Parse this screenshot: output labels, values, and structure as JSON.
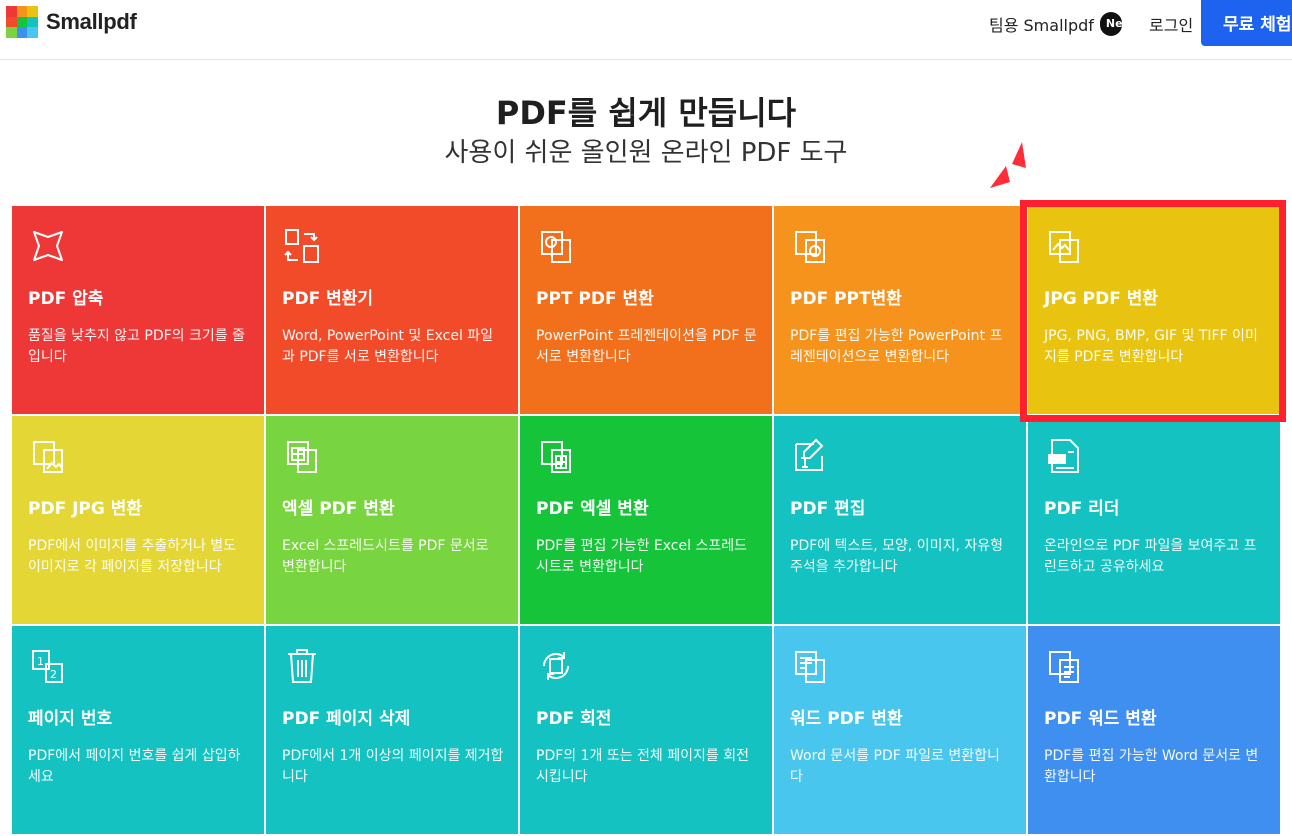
{
  "header": {
    "brand": "Smallpdf",
    "team_label": "팀용 Smallpdf",
    "new_badge": "New",
    "login_label": "로그인",
    "trial_label": "무료 체험"
  },
  "hero": {
    "title": "PDF를 쉽게 만듭니다",
    "subtitle": "사용이 쉬운 올인원 온라인 PDF 도구"
  },
  "tools": [
    {
      "title": "PDF 압축",
      "desc": "품질을 낮추지 않고 PDF의 크기를 줄입니다",
      "color": "#ee3838",
      "icon": "compress-icon"
    },
    {
      "title": "PDF 변환기",
      "desc": "Word, PowerPoint 및 Excel 파일과 PDF를 서로 변환합니다",
      "color": "#f24b2a",
      "icon": "convert-icon"
    },
    {
      "title": "PPT PDF 변환",
      "desc": "PowerPoint 프레젠테이션을 PDF 문서로 변환합니다",
      "color": "#f26f1c",
      "icon": "ppt-to-pdf-icon"
    },
    {
      "title": "PDF PPT변환",
      "desc": "PDF를 편집 가능한 PowerPoint 프레젠테이션으로 변환합니다",
      "color": "#f6931d",
      "icon": "pdf-to-ppt-icon"
    },
    {
      "title": "JPG PDF 변환",
      "desc": "JPG, PNG, BMP, GIF 및 TIFF 이미지를 PDF로 변환합니다",
      "color": "#e8c30f",
      "icon": "jpg-to-pdf-icon"
    },
    {
      "title": "PDF JPG 변환",
      "desc": "PDF에서 이미지를 추출하거나 별도 이미지로 각 페이지를 저장합니다",
      "color": "#e3d635",
      "icon": "pdf-to-jpg-icon"
    },
    {
      "title": "엑셀 PDF 변환",
      "desc": "Excel 스프레드시트를 PDF 문서로 변환합니다",
      "color": "#78d43f",
      "icon": "excel-to-pdf-icon"
    },
    {
      "title": "PDF 엑셀 변환",
      "desc": "PDF를 편집 가능한 Excel 스프레드시트로 변환합니다",
      "color": "#16c43a",
      "icon": "pdf-to-excel-icon"
    },
    {
      "title": "PDF 편집",
      "desc": "PDF에 텍스트, 모양, 이미지, 자유형 주석을 추가합니다",
      "color": "#14c2c2",
      "icon": "edit-pdf-icon"
    },
    {
      "title": "PDF 리더",
      "desc": "온라인으로 PDF 파일을 보여주고 프린트하고 공유하세요",
      "color": "#14c2c2",
      "icon": "pdf-reader-icon"
    },
    {
      "title": "페이지 번호",
      "desc": "PDF에서 페이지 번호를 쉽게 삽입하세요",
      "color": "#14c2c2",
      "icon": "page-numbers-icon"
    },
    {
      "title": "PDF 페이지 삭제",
      "desc": "PDF에서 1개 이상의 페이지를 제거합니다",
      "color": "#14c2c2",
      "icon": "trash-icon"
    },
    {
      "title": "PDF 회전",
      "desc": "PDF의 1개 또는 전체 페이지를 회전시킵니다",
      "color": "#14c2c2",
      "icon": "rotate-icon"
    },
    {
      "title": "워드 PDF 변환",
      "desc": "Word 문서를 PDF 파일로 변환합니다",
      "color": "#48c6ee",
      "icon": "word-to-pdf-icon"
    },
    {
      "title": "PDF 워드 변환",
      "desc": "PDF를 편집 가능한 Word 문서로 변환합니다",
      "color": "#3f8ff0",
      "icon": "pdf-to-word-icon"
    }
  ]
}
